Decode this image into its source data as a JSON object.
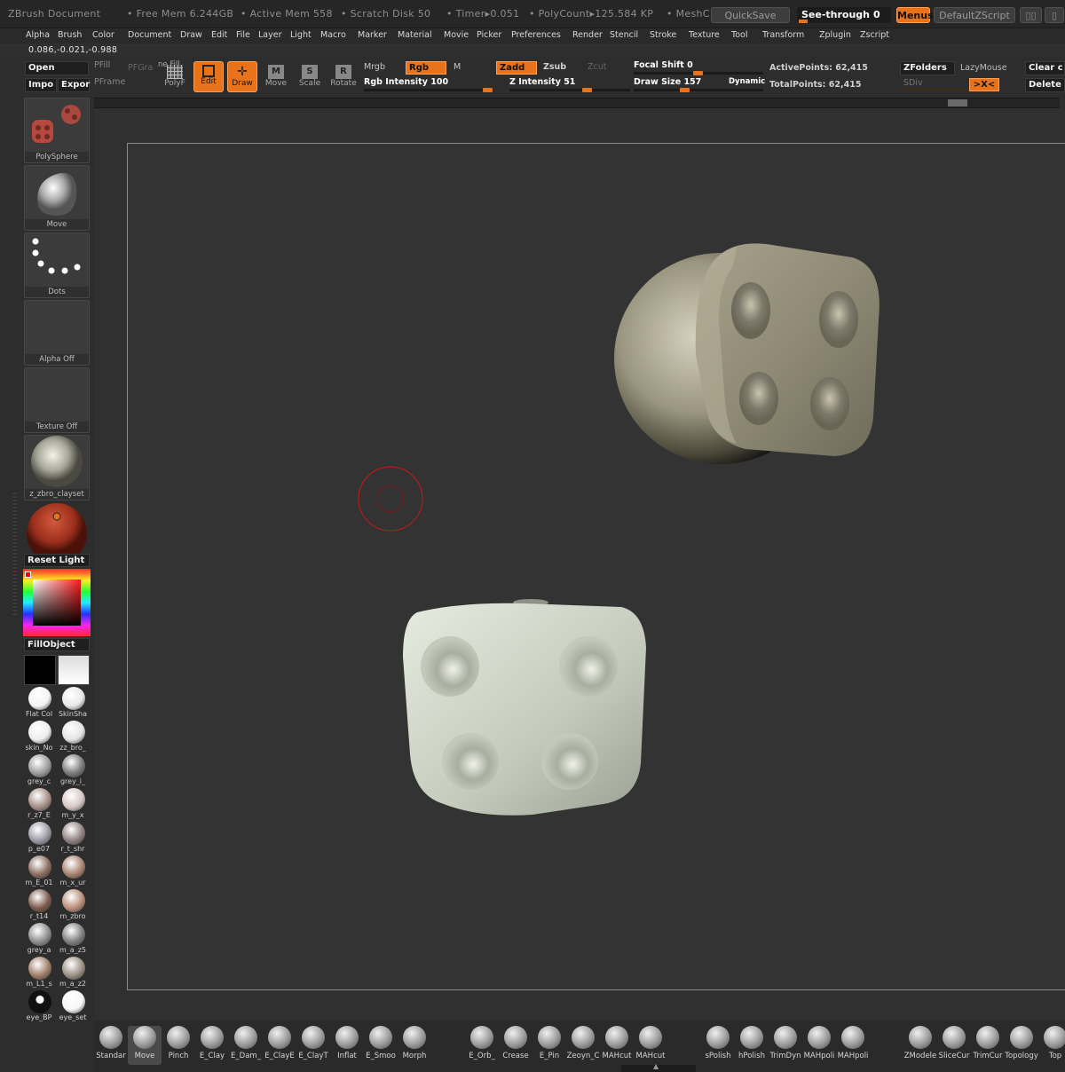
{
  "titlebar": {
    "app": "ZBrush Document",
    "free_mem": "• Free Mem 6.244GB",
    "active_mem": "• Active Mem 558",
    "scratch": "• Scratch Disk 50",
    "timer": "• Timer▸0.051",
    "polycount": "• PolyCount▸125.584 KP",
    "mesh": "• MeshC",
    "quicksave": "QuickSave",
    "see_through": "See-through",
    "see_through_value": "0",
    "menus": "Menus",
    "default_zscript": "DefaultZScript"
  },
  "menubar": [
    "Alpha",
    "Brush",
    "Color",
    "Document",
    "Draw",
    "Edit",
    "File",
    "Layer",
    "Light",
    "Macro",
    "Marker",
    "Material",
    "Movie",
    "Picker",
    "Preferences",
    "Render",
    "Stencil",
    "Stroke",
    "Texture",
    "Tool",
    "Transform",
    "Zplugin",
    "Zscript"
  ],
  "coords": "0.086,-0.021,-0.988",
  "toolbar": {
    "open": "Open",
    "import": "Impo",
    "export": "Expor",
    "pfill": "PFill",
    "pfgra": "PFGra",
    "pframe": "PFrame",
    "fill": "ne Fill",
    "polyf": "PolyF",
    "edit": "Edit",
    "draw": "Draw",
    "move": "Move",
    "scale": "Scale",
    "rotate": "Rotate",
    "mrgb": "Mrgb",
    "rgb": "Rgb",
    "m": "M",
    "zadd": "Zadd",
    "zsub": "Zsub",
    "zcut": "Zcut",
    "rgb_intensity": "Rgb  Intensity 100",
    "z_intensity": "Z  Intensity 51",
    "focal_shift": "Focal  Shift 0",
    "draw_size": "Draw  Size 157",
    "dynamic": "Dynamic",
    "active_points": "ActivePoints: 62,415",
    "total_points": "TotalPoints: 62,415",
    "zfolders": "ZFolders",
    "lazymouse": "LazyMouse",
    "sdiv": "SDiv",
    "xyz": ">X<",
    "clear": "Clear c",
    "delete": "Delete"
  },
  "shelf": {
    "tool": "PolySphere",
    "brush": "Move",
    "stroke": "Dots",
    "alpha": "Alpha  Off",
    "texture": "Texture  Off",
    "material": "z_zbro_clayset",
    "reset_light": "Reset  Light",
    "fill_object": "FillObject",
    "materials": [
      {
        "l": "Flat  Col",
        "c": "#f4f4f4"
      },
      {
        "l": "SkinSha",
        "c": "#e8e8e8"
      },
      {
        "l": "skin_No",
        "c": "#ededed"
      },
      {
        "l": "zz_bro_",
        "c": "#e4e4e4"
      },
      {
        "l": "grey_c",
        "c": "#9c9c9c"
      },
      {
        "l": "grey_i_",
        "c": "#7a7a7a"
      },
      {
        "l": "r_z7_E",
        "c": "#a58f86"
      },
      {
        "l": "m_y_x",
        "c": "#d6c7c5"
      },
      {
        "l": "p_e07",
        "c": "#9a9aa4"
      },
      {
        "l": "r_t_shr",
        "c": "#8f8080"
      },
      {
        "l": "m_E_01",
        "c": "#8a6d60"
      },
      {
        "l": "m_x_ur",
        "c": "#a8826f"
      },
      {
        "l": "r_t14",
        "c": "#7c5a4d"
      },
      {
        "l": "m_zbro",
        "c": "#b98e78"
      },
      {
        "l": "grey_a",
        "c": "#8d8d8d"
      },
      {
        "l": "m_a_z5",
        "c": "#7e7e7e"
      },
      {
        "l": "m_L1_s",
        "c": "#a07d6a"
      },
      {
        "l": "m_a_z2",
        "c": "#9a8f82"
      },
      {
        "l": "eye_BP",
        "c": "#111111"
      },
      {
        "l": "eye_set",
        "c": "#f8f8f8"
      }
    ]
  },
  "brushes": [
    "Standar",
    "Move",
    "Pinch",
    "E_Clay",
    "E_Dam_",
    "E_ClayE",
    "E_ClayT",
    "Inflat",
    "E_Smoo",
    "Morph",
    "E_Orb_",
    "Crease",
    "E_Pin",
    "Zeoyn_C",
    "MAHcut",
    "MAHcut",
    "sPolish",
    "hPolish",
    "TrimDyn",
    "MAHpoli",
    "MAHpoli",
    "ZModele",
    "SliceCur",
    "TrimCur",
    "Topology",
    "Top"
  ]
}
